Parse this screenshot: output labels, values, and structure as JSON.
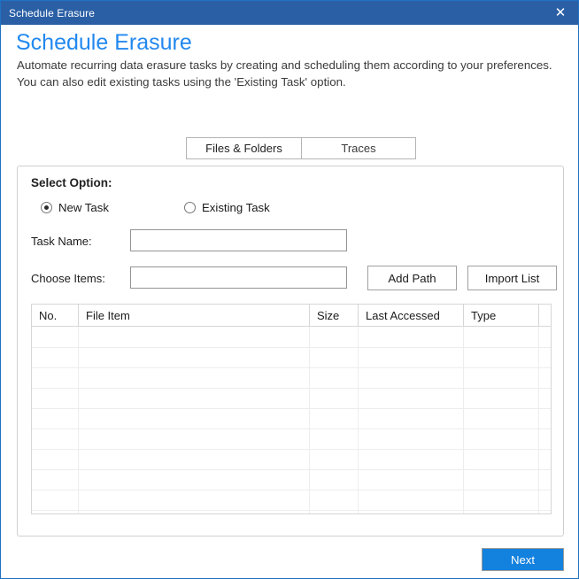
{
  "window": {
    "title": "Schedule Erasure",
    "close_icon": "close-icon",
    "close_glyph": "✕",
    "accent_color": "#2288ef",
    "titlebar_color": "#2a5fa5",
    "primary_button_color": "#1381de"
  },
  "header": {
    "title": "Schedule Erasure",
    "subtitle": "Automate recurring data erasure tasks by creating and scheduling them according to your preferences. You can also edit existing tasks using the 'Existing Task' option."
  },
  "tabs": [
    {
      "label": "Files & Folders",
      "selected": true
    },
    {
      "label": "Traces",
      "selected": false
    }
  ],
  "select_option": {
    "title": "Select Option:",
    "radios": [
      {
        "label": "New Task",
        "checked": true
      },
      {
        "label": "Existing Task",
        "checked": false
      }
    ],
    "fields": [
      {
        "label": "Task Name:",
        "value": "",
        "placeholder": ""
      },
      {
        "label": "Choose Items:",
        "value": "",
        "placeholder": ""
      }
    ],
    "buttons": [
      {
        "label": "Add Path"
      },
      {
        "label": "Import List"
      }
    ]
  },
  "table": {
    "columns": [
      "No.",
      "File Item",
      "Size",
      "Last Accessed",
      "Type",
      ""
    ],
    "rows": [],
    "empty_row_count": 10
  },
  "footer": {
    "next_label": "Next"
  }
}
